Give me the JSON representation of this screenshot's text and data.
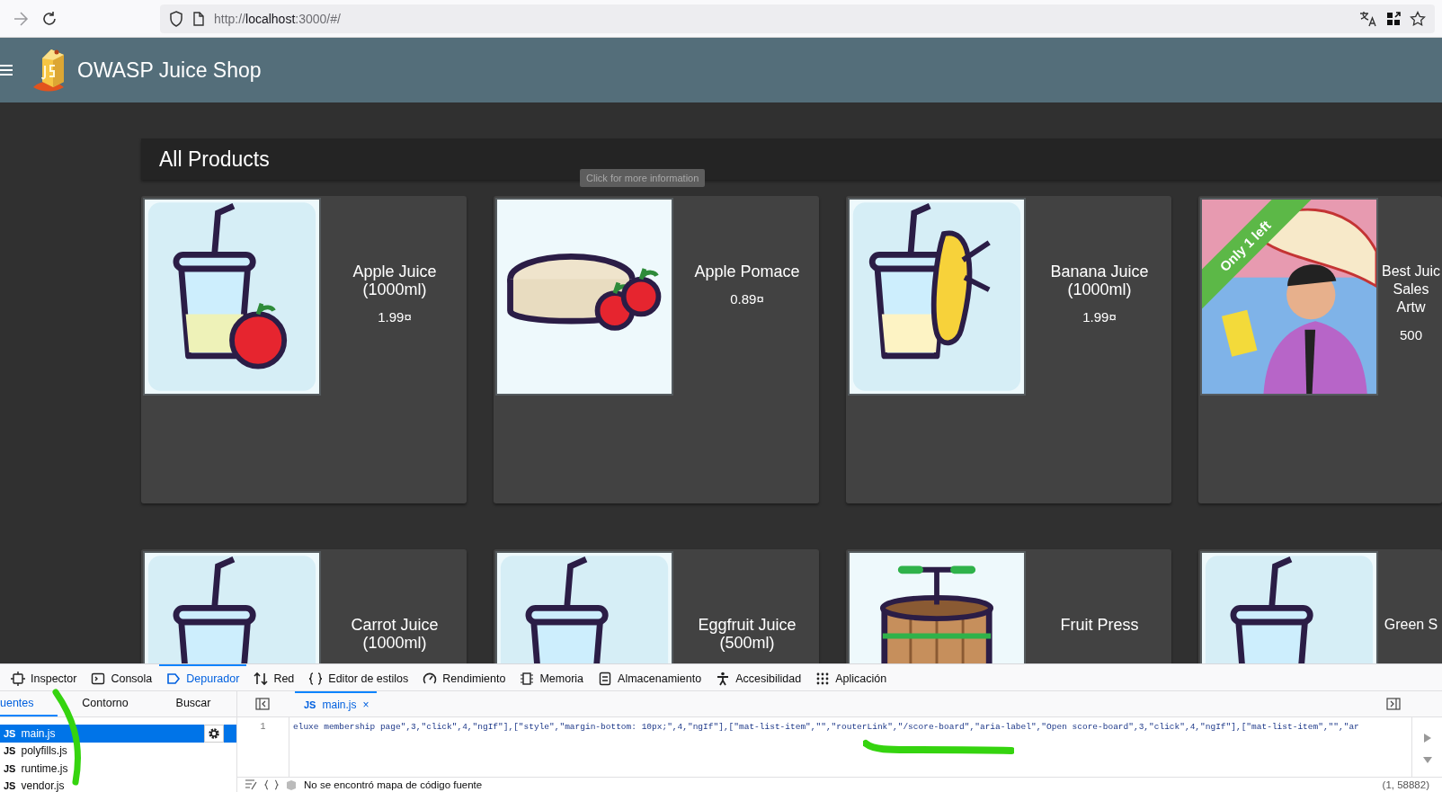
{
  "browser": {
    "url": "http://**localhost**:3000/#/"
  },
  "app": {
    "title": "OWASP Juice Shop"
  },
  "products": {
    "heading": "All Products",
    "tooltip": "Click for more information",
    "items": [
      {
        "name": "Apple Juice\n(1000ml)",
        "price": "1.99¤"
      },
      {
        "name": "Apple Pomace",
        "price": "0.89¤"
      },
      {
        "name": "Banana Juice\n(1000ml)",
        "price": "1.99¤"
      },
      {
        "name": "Best Juic\nSales\nArtw",
        "price": "500",
        "badge": "Only 1 left"
      },
      {
        "name": "Carrot Juice\n(1000ml)"
      },
      {
        "name": "Eggfruit Juice\n(500ml)"
      },
      {
        "name": "Fruit Press"
      },
      {
        "name": "Green S"
      }
    ]
  },
  "devtools": {
    "tabs": [
      {
        "label": "Inspector",
        "selected": false
      },
      {
        "label": "Consola",
        "selected": false
      },
      {
        "label": "Depurador",
        "selected": true
      },
      {
        "label": "Red",
        "selected": false
      },
      {
        "label": "Editor de estilos",
        "selected": false
      },
      {
        "label": "Rendimiento",
        "selected": false
      },
      {
        "label": "Memoria",
        "selected": false
      },
      {
        "label": "Almacenamiento",
        "selected": false
      },
      {
        "label": "Accesibilidad",
        "selected": false
      },
      {
        "label": "Aplicación",
        "selected": false
      }
    ],
    "source_tabs": [
      {
        "label": "uentes",
        "selected": true
      },
      {
        "label": "Contorno",
        "selected": false
      },
      {
        "label": "Buscar",
        "selected": false
      }
    ],
    "files": [
      {
        "type": "JS",
        "name": "main.js",
        "selected": true
      },
      {
        "type": "JS",
        "name": "polyfills.js",
        "selected": false
      },
      {
        "type": "JS",
        "name": "runtime.js",
        "selected": false
      },
      {
        "type": "JS",
        "name": "vendor.js",
        "selected": false
      }
    ],
    "editor_tab": {
      "type": "JS",
      "label": "main.js",
      "close": "×"
    },
    "line_number": "1",
    "code": "eluxe membership page\",3,\"click\",4,\"ngIf\"],[\"style\",\"margin-bottom: 10px;\",4,\"ngIf\"],[\"mat-list-item\",\"\",\"routerLink\",\"/score-board\",\"aria-label\",\"Open score-board\",3,\"click\",4,\"ngIf\"],[\"mat-list-item\",\"\",\"ar",
    "status": "No se encontró mapa de código fuente",
    "position": "(1, 58882)"
  }
}
